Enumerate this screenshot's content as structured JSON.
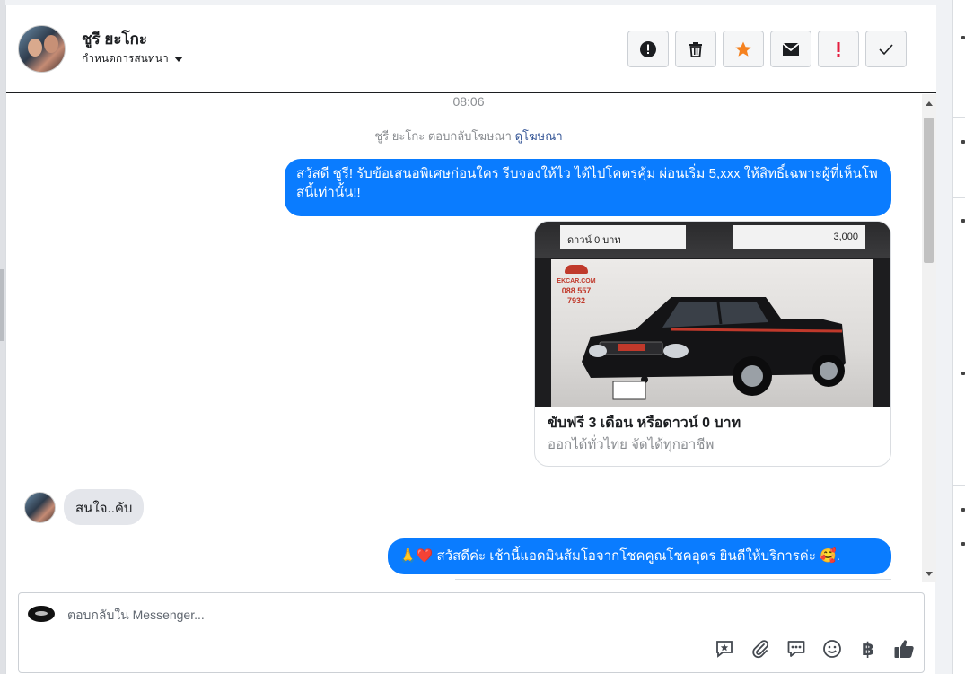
{
  "header": {
    "contact_name": "ชูรี ยะโกะ",
    "assign_label": "กำหนดการสนทนา",
    "actions": [
      {
        "name": "spam-button",
        "icon": "alert-circle-icon"
      },
      {
        "name": "delete-button",
        "icon": "trash-icon"
      },
      {
        "name": "star-button",
        "icon": "star-icon",
        "color": "#f5821f"
      },
      {
        "name": "mark-unread-button",
        "icon": "envelope-icon"
      },
      {
        "name": "follow-up-button",
        "icon": "exclamation-icon",
        "color": "#e41e3f"
      },
      {
        "name": "done-button",
        "icon": "check-icon"
      }
    ]
  },
  "chat": {
    "time": "08:06",
    "reply_note": "ชูรี ยะโกะ ตอบกลับโฆษณา",
    "reply_link": "ดูโฆษณา",
    "messages": {
      "out1": "สวัสดี ชูรี! รับข้อเสนอพิเศษก่อนใคร รีบจองให้ไว ได้ไปโคตรคุ้ม ผ่อนเริ่ม 5,xxx  ให้สิทธิ์เฉพาะผู้ที่เห็นโพสนี้เท่านั้น!!",
      "in1": "สนใจ..คับ",
      "out2": "🙏❤️ สวัสดีค่ะ เช้านี้แอดมินส้มโอจากโชคคูณโชคอุดร ยินดีให้บริการค่ะ 🥰."
    },
    "ad_card": {
      "tag_left": "ดาวน์ 0 บาท",
      "tag_right": "3,000",
      "logo_text": "EKCAR.COM",
      "logo_phone": "088 557 7932",
      "title": "ขับฟรี 3 เดือน หรือดาวน์ 0 บาท",
      "subtitle": "ออกได้ทั่วไทย จัดได้ทุกอาชีพ"
    }
  },
  "composer": {
    "placeholder": "ตอบกลับใน Messenger...",
    "value": "",
    "tools": [
      {
        "name": "saved-reply-button",
        "icon": "saved-reply-icon"
      },
      {
        "name": "attach-button",
        "icon": "paperclip-icon"
      },
      {
        "name": "quick-reply-button",
        "icon": "chat-bubble-icon"
      },
      {
        "name": "emoji-button",
        "icon": "smiley-icon"
      },
      {
        "name": "payment-button",
        "icon": "baht-icon"
      },
      {
        "name": "like-button",
        "icon": "thumbs-up-icon"
      }
    ],
    "baht_symbol": "฿"
  }
}
